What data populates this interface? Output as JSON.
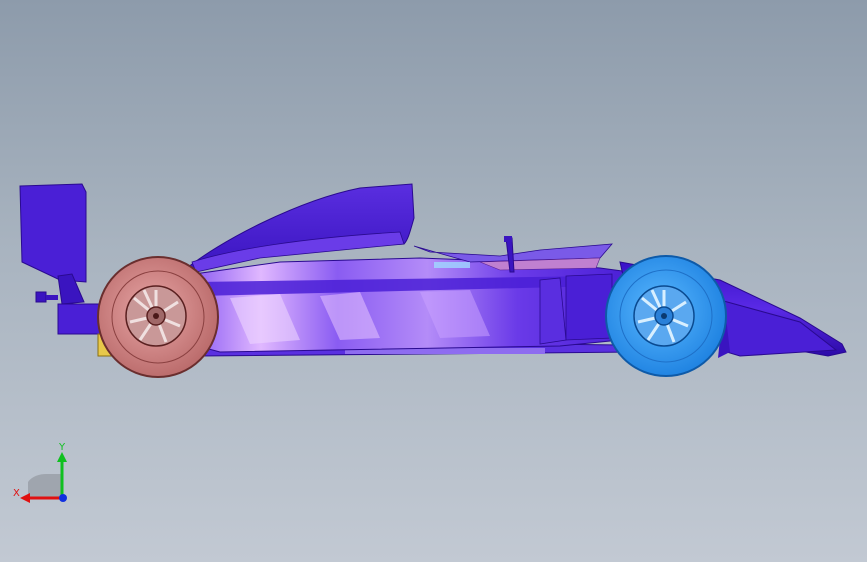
{
  "view": {
    "background_top": "#8d9bab",
    "background_bottom": "#c2c9d3"
  },
  "model": {
    "body_color": "#4a1fd6",
    "body_highlight": "#d6a8ff",
    "rear_wheel_color": "#d08080",
    "front_wheel_color": "#3aa0f5",
    "accent_color": "#e8c84a"
  },
  "triad": {
    "x_label": "X",
    "y_label": "Y",
    "x_color": "#e01010",
    "y_color": "#10c020",
    "z_color": "#1030e0"
  }
}
